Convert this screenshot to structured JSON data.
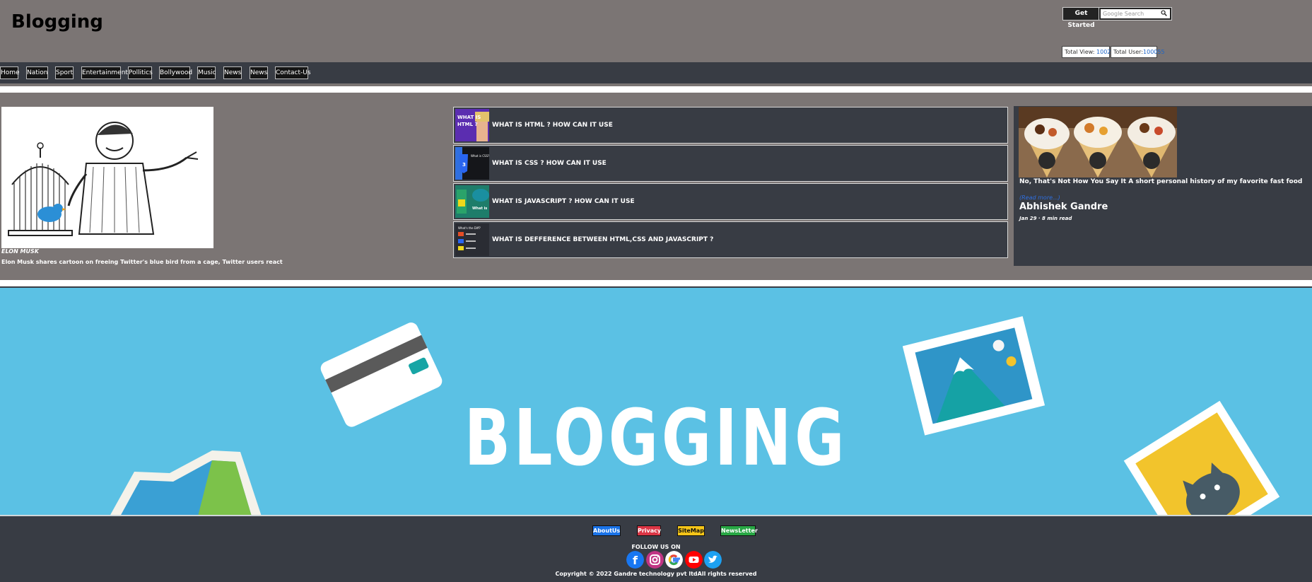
{
  "header": {
    "site_title": "Blogging",
    "get_started": "Get Started",
    "search_placeholder": "Google Search",
    "total_view_label": "Total View: ",
    "total_view_value": "10022",
    "total_user_label": "Total User:",
    "total_user_value": "100055"
  },
  "nav": {
    "items": [
      "Home",
      "Nation",
      "Sport",
      "Entertainment",
      "Pollitics",
      "Bollywood",
      "Music",
      "News",
      "News",
      "Contact-Us"
    ]
  },
  "feature": {
    "caption": "ELON MUSK",
    "description": "Elon Musk shares cartoon on freeing Twitter's blue bird from a cage, Twitter users react"
  },
  "articles": [
    {
      "title": "WHAT IS HTML ? HOW CAN IT USE",
      "thumb_text": "WHAT IS HTML ?"
    },
    {
      "title": "WHAT IS CSS ? HOW CAN IT USE",
      "thumb_text": "What is CSS?"
    },
    {
      "title": "WHAT IS JAVASCRIPT ? HOW CAN IT USE",
      "thumb_text": "What is JavaScript?"
    },
    {
      "title": "WHAT IS DEFFERENCE BETWEEN HTML,CSS AND JAVASCRIPT ?",
      "thumb_text": "What's the Difference?"
    }
  ],
  "side_card": {
    "title": "No, That's Not How You Say It A short personal history of my favorite fast food",
    "read_more": "(Read more...)",
    "author": "Abhishek Gandre",
    "meta": "Jan 29 · 8 min read"
  },
  "banner": {
    "title": "BLOGGING"
  },
  "footer": {
    "buttons": [
      "AboutUs",
      "Privacy",
      "SiteMap",
      "NewsLetter"
    ],
    "follow": "FOLLOW US ON",
    "social": [
      "facebook-icon",
      "instagram-icon",
      "google-icon",
      "youtube-icon",
      "twitter-icon"
    ],
    "copyright": "Copyright © 2022 Gandre technology pvt ltdAll rights reserved"
  },
  "colors": {
    "header_bg": "#7b7574",
    "nav_bg": "#383c44",
    "banner_bg": "#5bc1e4",
    "about_btn": "#1a73e8",
    "privacy_btn": "#dc3545",
    "sitemap_btn": "#f5c518",
    "newsletter_btn": "#28a745"
  }
}
